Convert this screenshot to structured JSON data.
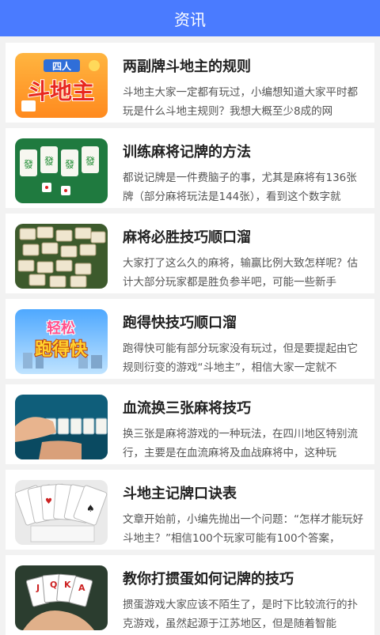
{
  "header": {
    "title": "资讯"
  },
  "articles": [
    {
      "title": "两副牌斗地主的规则",
      "desc": "斗地主大家一定都有玩过，小编想知道大家平时都玩是什么斗地主规则？我想大概至少8成的网",
      "thumb_text": "四人斗地主",
      "thumb_icon": "doudizhu-logo-icon"
    },
    {
      "title": "训练麻将记牌的方法",
      "desc": "都说记牌是一件费脑子的事，尤其是麻将有136张牌（部分麻将玩法是144张），看到这个数字就",
      "thumb_icon": "mahjong-tiles-dice-icon"
    },
    {
      "title": "麻将必胜技巧顺口溜",
      "desc": "大家打了这么久的麻将，输赢比例大致怎样呢？估计大部分玩家都是胜负参半吧，可能一些新手",
      "thumb_icon": "mahjong-pile-icon"
    },
    {
      "title": "跑得快技巧顺口溜",
      "desc": "跑得快可能有部分玩家没有玩过，但是要提起由它规则衍变的游戏“斗地主”，相信大家一定就不",
      "thumb_text": "轻松跑得快",
      "thumb_icon": "paodekuai-logo-icon"
    },
    {
      "title": "血流换三张麻将技巧",
      "desc": "换三张是麻将游戏的一种玩法，在四川地区特别流行，主要是在血流麻将及血战麻将中，这种玩",
      "thumb_icon": "mahjong-hand-icon"
    },
    {
      "title": "斗地主记牌口诀表",
      "desc": "文章开始前，小编先抛出一个问题：“怎样才能玩好斗地主？”相信100个玩家可能有100个答案，",
      "thumb_icon": "playing-cards-icon"
    },
    {
      "title": "教你打掼蛋如何记牌的技巧",
      "desc": "掼蛋游戏大家应该不陌生了，是时下比较流行的扑克游戏，虽然起源于江苏地区，但是随着智能",
      "thumb_text": "JQKA",
      "thumb_icon": "poker-hand-icon"
    }
  ],
  "colors": {
    "header": "#4a7bff",
    "background": "#f2f2f2"
  }
}
